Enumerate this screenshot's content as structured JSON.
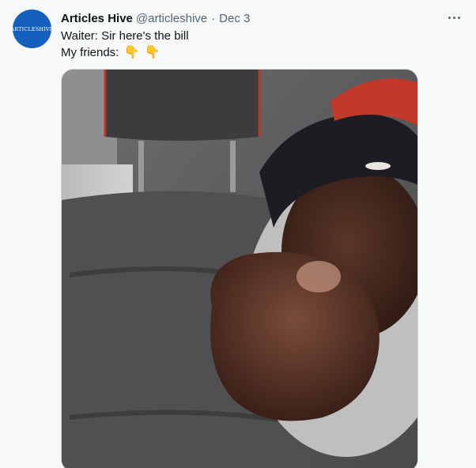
{
  "tweet": {
    "author_name": "Articles Hive",
    "author_handle": "@articleshive",
    "separator": "·",
    "date": "Dec 3",
    "avatar_text": "ARTICLESHIVE",
    "text_line1": "Waiter: Sir here's the bill",
    "text_line2_prefix": "My friends:",
    "emoji": [
      "👇",
      "👇"
    ],
    "media_icon": "video-thumbnail"
  },
  "colors": {
    "background": "#f7f9f9",
    "text_primary": "#0f1419",
    "text_secondary": "#536471",
    "avatar_bg": "#1560bd",
    "media_border": "#cfd9de"
  },
  "icons": {
    "more": "more-horizontal-icon"
  }
}
